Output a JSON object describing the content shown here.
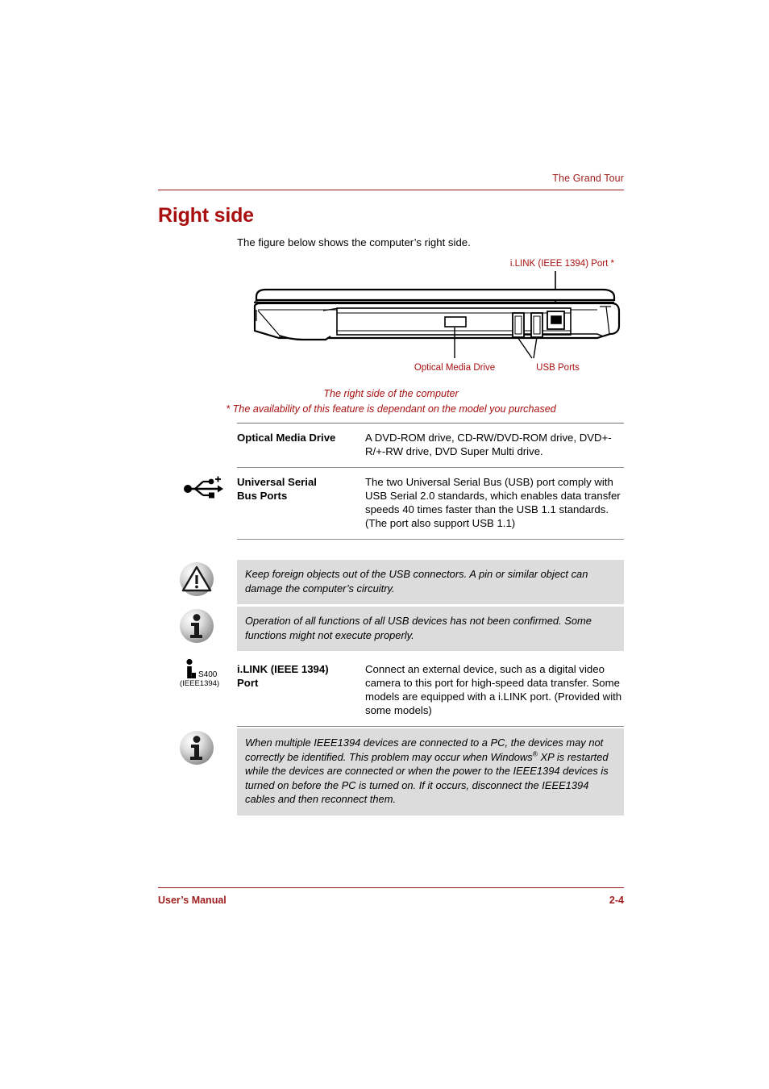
{
  "header": {
    "chapter": "The Grand Tour"
  },
  "title": "Right side",
  "intro": "The figure below shows the computer’s right side.",
  "figure": {
    "callouts": {
      "ilink": "i.LINK (IEEE 1394) Port *",
      "optical": "Optical Media Drive",
      "usb": "USB Ports"
    },
    "caption_line1": "The right side of the computer",
    "caption_line2": "* The availability of this feature is dependant on the model you purchased"
  },
  "spec_rows": [
    {
      "icon": null,
      "label": "Optical Media Drive",
      "description": "A DVD-ROM drive, CD-RW/DVD-ROM drive, DVD+-R/+-RW drive, DVD Super Multi drive."
    },
    {
      "icon": "usb-icon",
      "label": "Universal Serial Bus Ports",
      "label_line1": "Universal Serial",
      "label_line2": "Bus Ports",
      "description": "The two Universal Serial Bus (USB) port comply with USB Serial 2.0 standards, which enables data transfer speeds 40 times faster than the USB 1.1 standards. (The port also support USB 1.1)"
    },
    {
      "icon": "ilink-icon",
      "label": "i.LINK (IEEE 1394) Port",
      "label_line1": "i.LINK (IEEE 1394)",
      "label_line2": "Port",
      "description": "Connect an external device, such as a digital video camera to this port for high-speed data transfer. Some models are equipped with a i.LINK port. (Provided with some models)"
    }
  ],
  "ilink_icon_text": {
    "speed": "S400",
    "standard": "(IEEE1394)"
  },
  "notes": [
    {
      "icon": "caution-triangle-icon",
      "text": "Keep foreign objects out of the USB connectors. A pin or similar object can damage the computer’s circuitry."
    },
    {
      "icon": "info-icon",
      "text": "Operation of all functions of all USB devices has not been confirmed. Some functions might not execute properly."
    }
  ],
  "note_ieee": {
    "icon": "info-icon",
    "part1": "When multiple IEEE1394 devices are connected to a PC, the devices may not correctly be identified. This problem may occur when Windows",
    "registered": "®",
    "part2": " XP is restarted while the devices are connected or when the power to the IEEE1394 devices is turned on before the PC is turned on. If it occurs, disconnect the IEEE1394 cables and then reconnect them."
  },
  "footer": {
    "left": "User’s Manual",
    "page": "2-4"
  },
  "colors": {
    "accent_red": "#9E1B1B",
    "title_red": "#A81010",
    "note_bg": "#DCDCDC",
    "rule_gray": "#8a8a8a"
  }
}
